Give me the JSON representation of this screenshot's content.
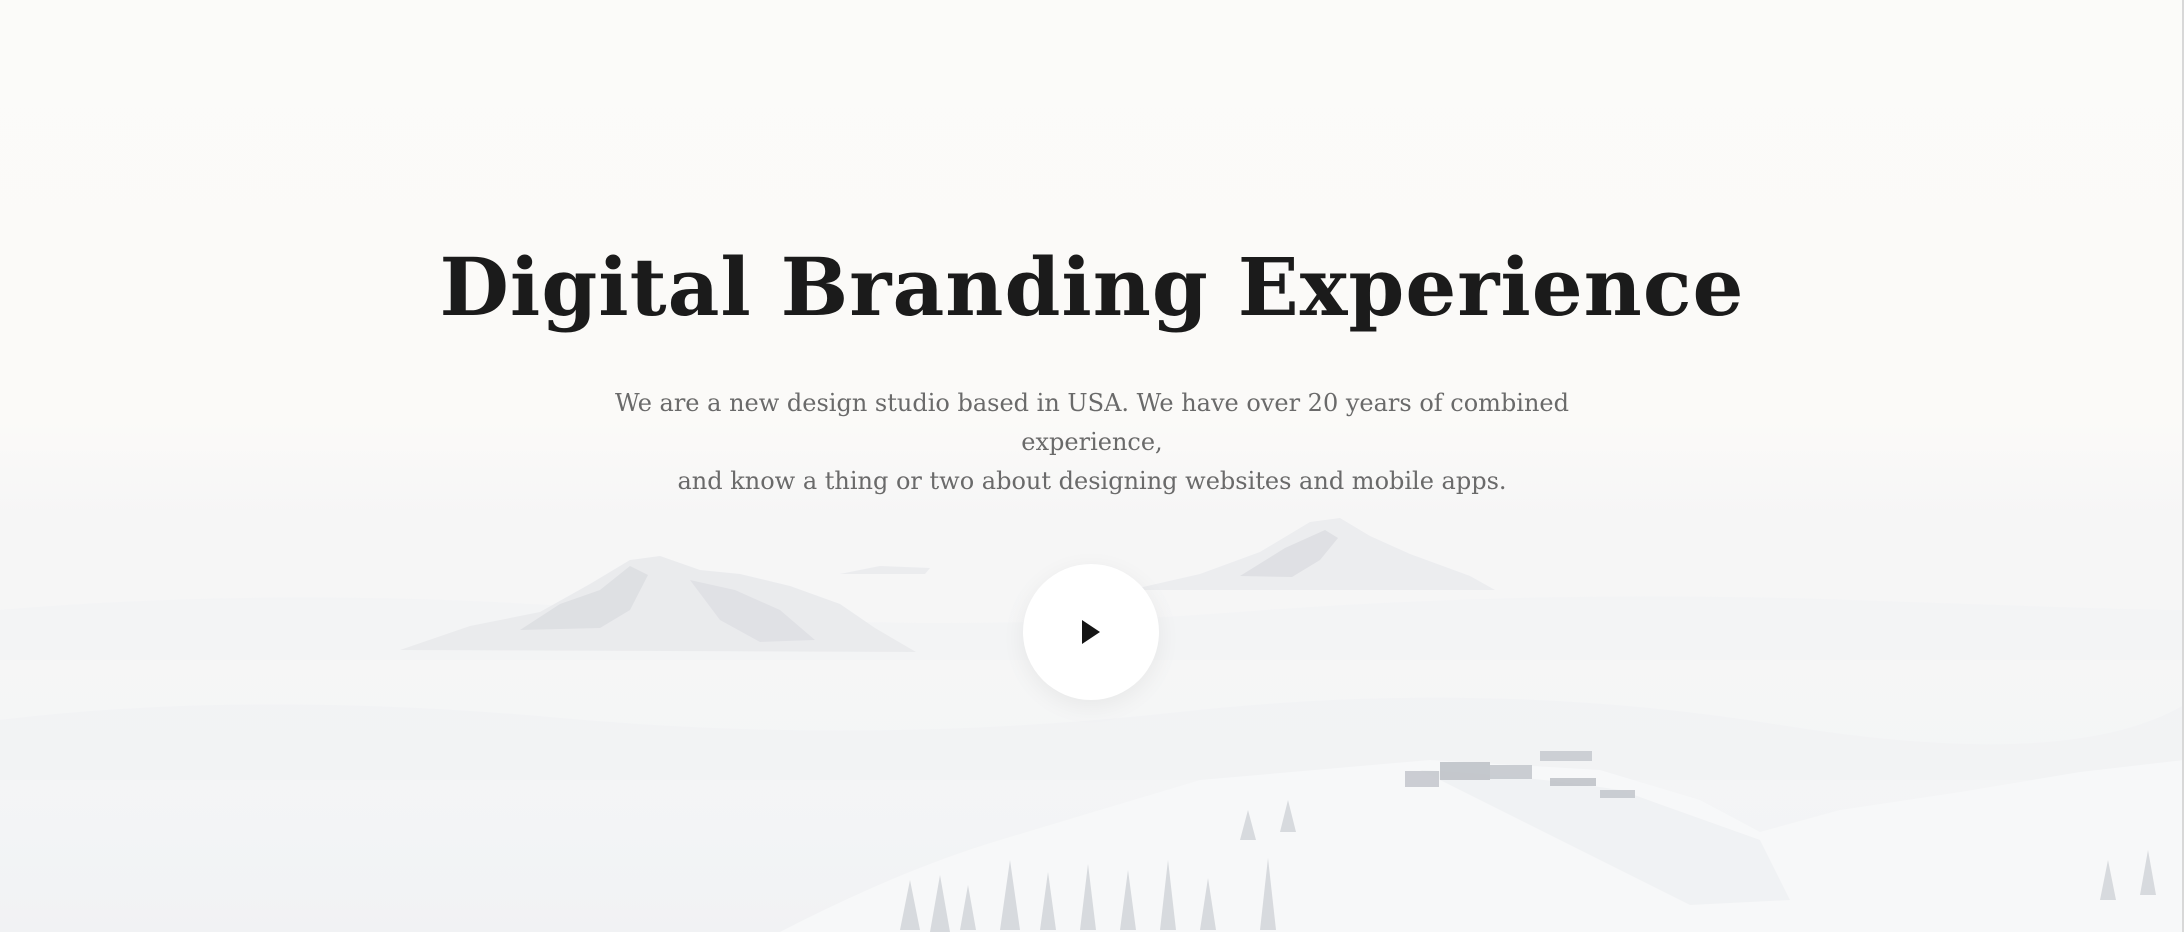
{
  "hero": {
    "title": "Digital Branding Experience",
    "subtitle_line1": "We are a new design studio based in USA. We have over 20 years of combined experience,",
    "subtitle_line2": "and know a thing or two about designing websites and mobile apps.",
    "play_icon": "play-icon",
    "background": "snowy mountain landscape above clouds",
    "colors": {
      "title": "#1b1b1b",
      "subtitle": "#6a6a6a",
      "button": "#ffffff",
      "icon": "#151515"
    }
  }
}
